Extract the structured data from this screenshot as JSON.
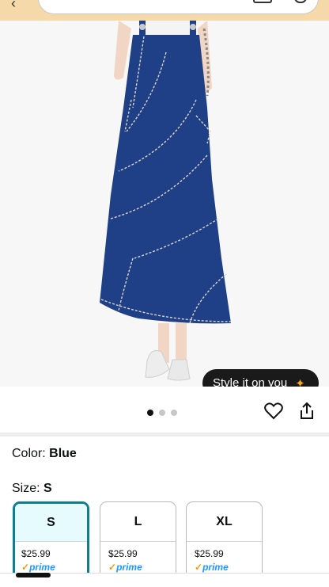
{
  "hero": {
    "style_button_label": "Style it on you",
    "sparkle_icon": "sparkle-icon"
  },
  "carousel": {
    "total": 3,
    "active_index": 0
  },
  "color": {
    "label": "Color:",
    "value": "Blue"
  },
  "size": {
    "label": "Size:",
    "value": "S",
    "options": [
      {
        "size": "S",
        "price": "$25.99",
        "prime": "prime",
        "selected": true
      },
      {
        "size": "L",
        "price": "$25.99",
        "prime": "prime",
        "selected": false
      },
      {
        "size": "XL",
        "price": "$25.99",
        "prime": "prime",
        "selected": false
      }
    ]
  },
  "colors": {
    "accent": "#0f7f8f",
    "prime_blue": "#1a98ff",
    "dress": "#1f3f86"
  }
}
